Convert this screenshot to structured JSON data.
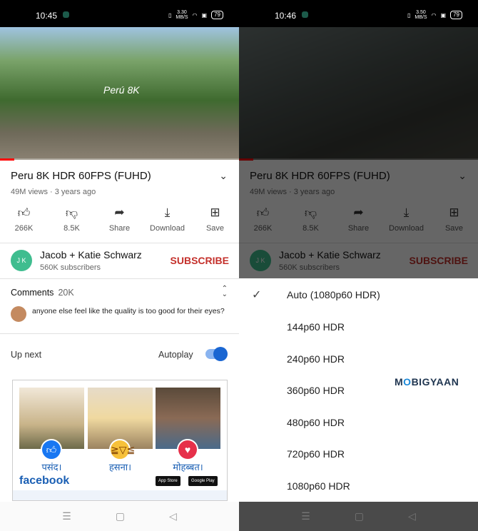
{
  "left": {
    "status": {
      "time": "10:45",
      "speed": "3.30",
      "speed_unit": "MB/S",
      "battery": "79"
    }
  },
  "right": {
    "status": {
      "time": "10:46",
      "speed": "3.50",
      "speed_unit": "MB/S",
      "battery": "79"
    }
  },
  "video": {
    "overlay_logo": "Perú 8K",
    "title": "Peru 8K HDR 60FPS (FUHD)",
    "meta": "49M views · 3 years ago",
    "progress_percent": 6
  },
  "actions": [
    {
      "icon": "thumbs-up-icon",
      "label": "266K"
    },
    {
      "icon": "thumbs-down-icon",
      "label": "8.5K"
    },
    {
      "icon": "share-icon",
      "label": "Share"
    },
    {
      "icon": "download-icon",
      "label": "Download"
    },
    {
      "icon": "save-icon",
      "label": "Save"
    }
  ],
  "channel": {
    "avatar_text": "J K",
    "name": "Jacob + Katie Schwarz",
    "subscribers": "560K subscribers",
    "subscribe": "SUBSCRIBE"
  },
  "comments": {
    "label": "Comments",
    "count": "20K",
    "top_comment": "anyone else feel like the quality is too good for their eyes?"
  },
  "upnext": {
    "label": "Up next",
    "autoplay": "Autoplay",
    "autoplay_on": true
  },
  "ad": {
    "captions": [
      "पसंद।",
      "हसना।",
      "मोहब्बत।"
    ],
    "brand": "facebook",
    "app_store": "App Store",
    "google_play": "Google Play"
  },
  "quality_menu": {
    "options": [
      "Auto (1080p60 HDR)",
      "144p60 HDR",
      "240p60 HDR",
      "360p60 HDR",
      "480p60 HDR",
      "720p60 HDR",
      "1080p60 HDR"
    ],
    "selected": "Auto (1080p60 HDR)"
  },
  "watermark": {
    "pre": "M",
    "o": "O",
    "post": "BIGYAAN"
  },
  "colors": {
    "subscribe": "#c4302b",
    "accent": "#1a66d2",
    "progress": "#ff0000"
  }
}
